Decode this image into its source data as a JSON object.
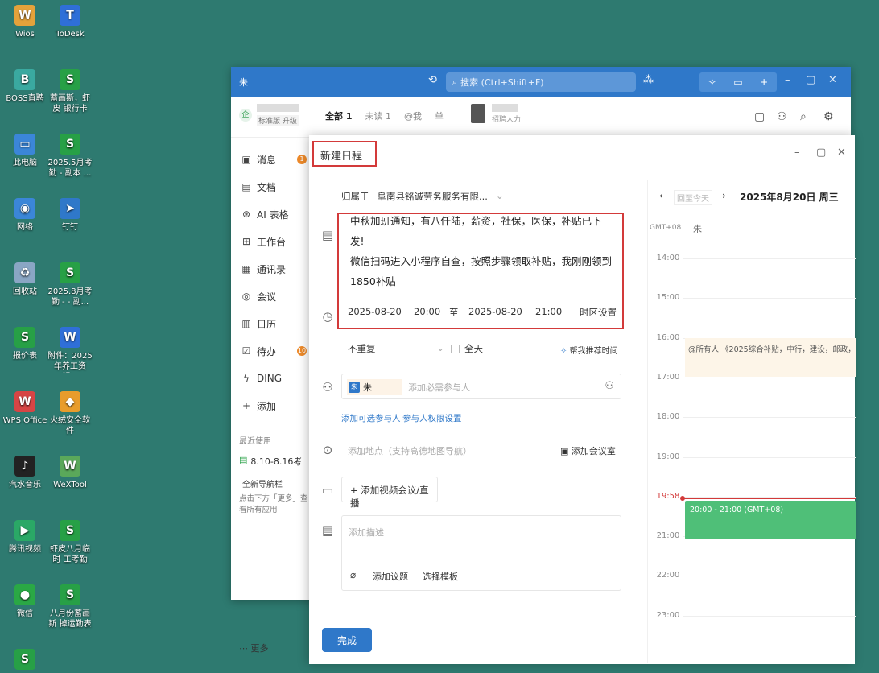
{
  "desktop": {
    "icons": [
      {
        "label": "Wios",
        "color": "#e4a23b",
        "glyph": "W"
      },
      {
        "label": "ToDesk",
        "color": "#2f6fd8",
        "glyph": "T"
      },
      {
        "label": "BOSS直聘",
        "color": "#3aa9a0",
        "glyph": "B"
      },
      {
        "label": "蓄画斯，虾皮\n银行卡",
        "color": "#27a046",
        "glyph": "S"
      },
      {
        "label": "此电脑",
        "color": "#3b86d8",
        "glyph": "▭"
      },
      {
        "label": "2025.5月考\n勤 - 副本 ...",
        "color": "#27a046",
        "glyph": "S"
      },
      {
        "label": "网络",
        "color": "#3b86d8",
        "glyph": "◉"
      },
      {
        "label": "钉钉",
        "color": "#2f78c9",
        "glyph": "➤"
      },
      {
        "label": "回收站",
        "color": "#8aa6c4",
        "glyph": "♻"
      },
      {
        "label": "2025.8月考\n勤 - - 副...",
        "color": "#27a046",
        "glyph": "S"
      },
      {
        "label": "报价表",
        "color": "#27a046",
        "glyph": "S"
      },
      {
        "label": "附件：2025\n年养工资明...",
        "color": "#2f6fd8",
        "glyph": "W"
      },
      {
        "label": "WPS Office",
        "color": "#d64545",
        "glyph": "W"
      },
      {
        "label": "火绒安全软件",
        "color": "#e89c2c",
        "glyph": "◆"
      },
      {
        "label": "汽水音乐",
        "color": "#222222",
        "glyph": "♪"
      },
      {
        "label": "WeXTool",
        "color": "#5aa85a",
        "glyph": "W"
      },
      {
        "label": "腾讯视频",
        "color": "#2aa866",
        "glyph": "▶"
      },
      {
        "label": "虾皮八月临时\n工考勤",
        "color": "#27a046",
        "glyph": "S"
      },
      {
        "label": "微信",
        "color": "#2aa845",
        "glyph": "●"
      },
      {
        "label": "八月份蓄画斯\n掉运勤表",
        "color": "#27a046",
        "glyph": "S"
      },
      {
        "label": "",
        "color": "#27a046",
        "glyph": "S"
      }
    ]
  },
  "main": {
    "window_title": "朱",
    "search_placeholder": "搜索 (Ctrl+Shift+F)",
    "account_line1": "",
    "account_tag": "标准版 升级",
    "tabs": [
      "全部 1",
      "未读 1",
      "@我",
      "单"
    ],
    "chat_sub": "招聘人力",
    "sidebar": [
      {
        "icon": "▣",
        "label": "消息",
        "badge": "1"
      },
      {
        "icon": "▤",
        "label": "文档",
        "badge": ""
      },
      {
        "icon": "⊛",
        "label": "AI 表格",
        "badge": ""
      },
      {
        "icon": "⊞",
        "label": "工作台",
        "badge": ""
      },
      {
        "icon": "▦",
        "label": "通讯录",
        "badge": ""
      },
      {
        "icon": "◎",
        "label": "会议",
        "badge": ""
      },
      {
        "icon": "▥",
        "label": "日历",
        "badge": ""
      },
      {
        "icon": "☑",
        "label": "待办",
        "badge": "10"
      },
      {
        "icon": "ϟ",
        "label": "DING",
        "badge": ""
      },
      {
        "icon": "+",
        "label": "添加",
        "badge": ""
      }
    ],
    "recent_title": "最近使用",
    "recent_item": "8.10-8.16考",
    "recent_nav": "全新导航栏",
    "recent_hint": "点击下方「更多」查看所有应用",
    "more": "更多"
  },
  "dialog": {
    "title": "新建日程",
    "belongs_label": "归属于",
    "belongs_value": "阜南县铭诚劳务服务有限...",
    "body_lines": [
      "中秋加班通知，有八仟陆，薪资，社保，医保，补贴已下",
      "发!",
      "微信扫码进入小程序自查，按照步骤领取补贴，我刚刚领到",
      "1850补贴"
    ],
    "start_date": "2025-08-20",
    "start_time": "20:00",
    "to": "至",
    "end_date": "2025-08-20",
    "end_time": "21:00",
    "timezone": "时区设置",
    "repeat": "不重复",
    "allday": "全天",
    "find_time": "帮我推荐时间",
    "participant": "朱",
    "participant_placeholder": "添加必需参与人",
    "add_optional": "添加可选参与人",
    "perm": "参与人权限设置",
    "location_placeholder": "添加地点（支持高德地图导航）",
    "add_room": "添加会议室",
    "add_video": "添加视频会议/直播",
    "desc_placeholder": "添加描述",
    "add_topic": "添加议题",
    "template": "选择模板",
    "done": "完成"
  },
  "calendar": {
    "nav_label": "回至今天",
    "date_title": "2025年8月20日 周三",
    "tz": "GMT+08",
    "user": "朱",
    "hours": [
      "14:00",
      "15:00",
      "16:00",
      "17:00",
      "18:00",
      "19:00",
      "19:58",
      "21:00",
      "22:00",
      "23:00"
    ],
    "event1": "@所有人 《2025综合补贴，中行，建设，邮政，...",
    "event2": "20:00 - 21:00 (GMT+08)",
    "now_color": "#d33a3a",
    "event_color": "#4fbf78"
  }
}
